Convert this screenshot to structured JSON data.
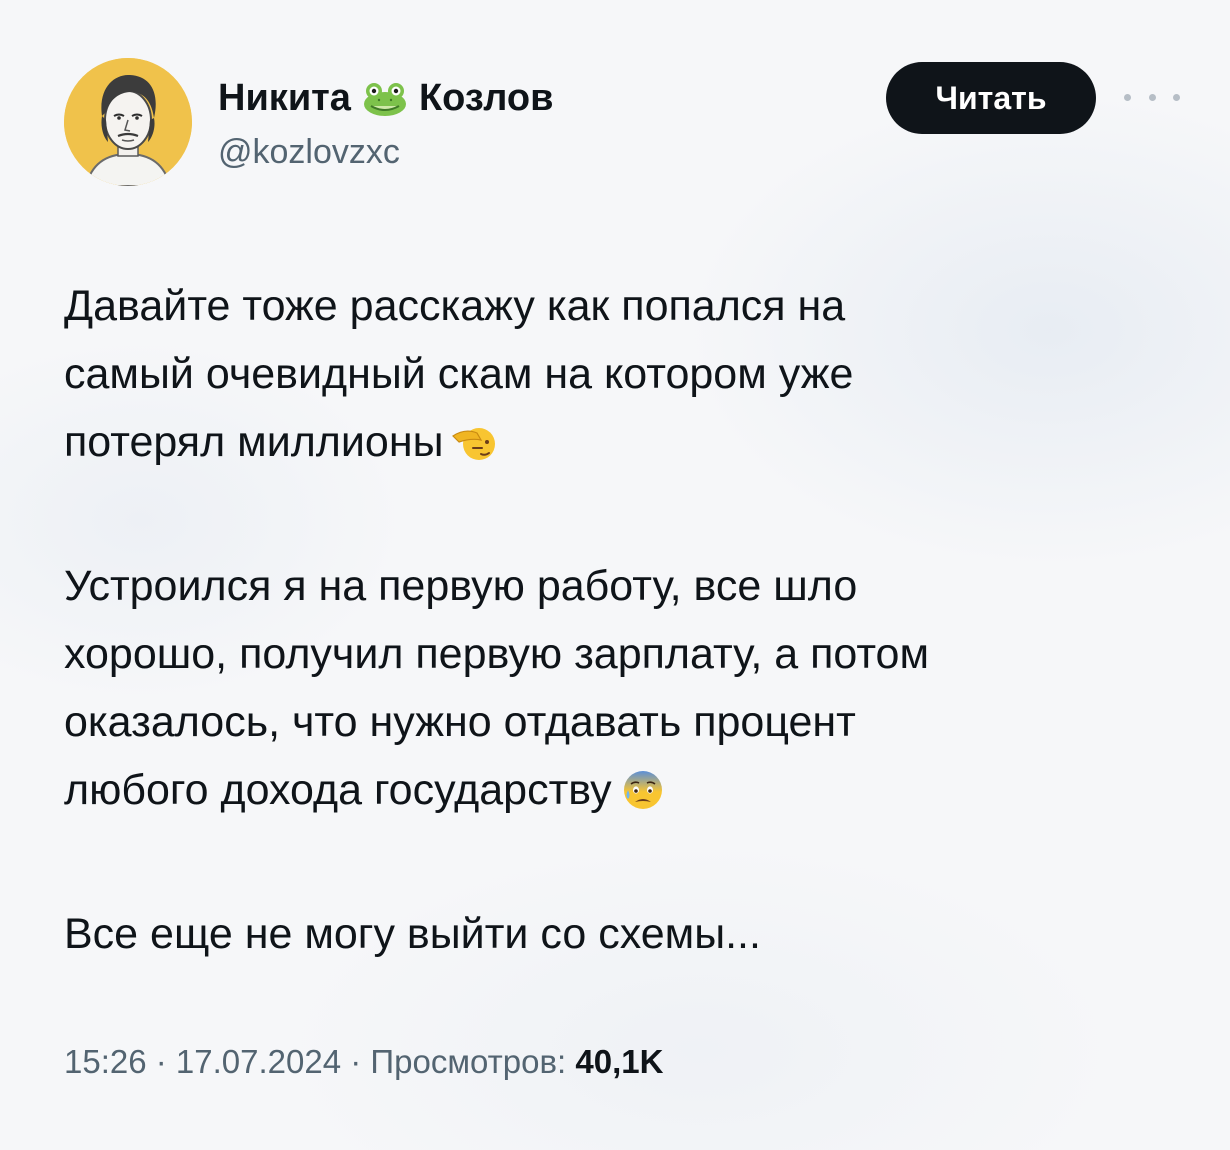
{
  "author": {
    "first_name": "Никита",
    "last_name": "Козлов",
    "name_emoji": "frog-emoji",
    "handle": "@kozlovzxc",
    "avatar": "avatar-portrait"
  },
  "header": {
    "follow_label": "Читать",
    "more_icon": "more-dots-icon"
  },
  "tweet": {
    "paragraphs": [
      {
        "lines": [
          "Давайте тоже расскажу как попался на",
          "самый очевидный скам на котором уже",
          "потерял миллионы"
        ],
        "emoji": "saluting-face-emoji"
      },
      {
        "lines": [
          "Устроился я на первую работу, все шло",
          "хорошо, получил первую зарплату, а потом",
          "оказалось, что нужно отдавать процент",
          "любого дохода государству"
        ],
        "emoji": "anxious-face-with-sweat-emoji"
      },
      {
        "lines": [
          "Все еще не могу выйти со схемы..."
        ]
      }
    ]
  },
  "meta": {
    "time": "15:26",
    "separator": " · ",
    "date": "17.07.2024",
    "views_label": "Просмотров:",
    "views_count": "40,1K"
  },
  "colors": {
    "text": "#0f1419",
    "secondary": "#536471",
    "button_bg": "#0f1419",
    "avatar_bg": "#f0c24b",
    "background": "#f6f7f9"
  }
}
